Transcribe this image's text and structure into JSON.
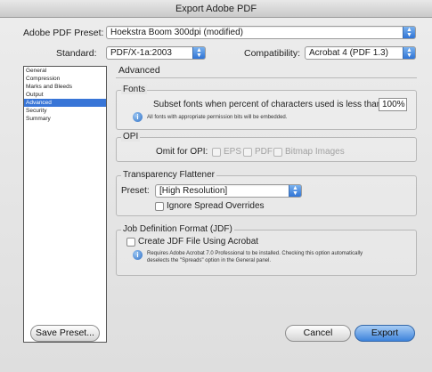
{
  "window": {
    "title": "Export Adobe PDF"
  },
  "preset": {
    "label": "Adobe PDF Preset:",
    "value": "Hoekstra Boom 300dpi (modified)"
  },
  "standard": {
    "label": "Standard:",
    "value": "PDF/X-1a:2003"
  },
  "compatibility": {
    "label": "Compatibility:",
    "value": "Acrobat 4 (PDF 1.3)"
  },
  "sidebar": {
    "items": [
      {
        "label": "General",
        "selected": false
      },
      {
        "label": "Compression",
        "selected": false
      },
      {
        "label": "Marks and Bleeds",
        "selected": false
      },
      {
        "label": "Output",
        "selected": false
      },
      {
        "label": "Advanced",
        "selected": true
      },
      {
        "label": "Security",
        "selected": false
      },
      {
        "label": "Summary",
        "selected": false
      }
    ]
  },
  "panel": {
    "title": "Advanced"
  },
  "fonts": {
    "title": "Fonts",
    "subset_label": "Subset fonts when percent of characters used is less than:",
    "subset_value": "100%",
    "note": "All fonts with appropriate permission bits will be embedded."
  },
  "opi": {
    "title": "OPI",
    "omit_label": "Omit for OPI:",
    "options": [
      {
        "label": "EPS"
      },
      {
        "label": "PDF"
      },
      {
        "label": "Bitmap Images"
      }
    ]
  },
  "transparency": {
    "title": "Transparency Flattener",
    "preset_label": "Preset:",
    "preset_value": "[High Resolution]",
    "ignore_label": "Ignore Spread Overrides"
  },
  "jdf": {
    "title": "Job Definition Format (JDF)",
    "create_label": "Create JDF File Using Acrobat",
    "note_line1": "Requires Adobe Acrobat 7.0 Professional to be installed. Checking this option automatically",
    "note_line2": "deselects the \"Spreads\" option in the General panel."
  },
  "buttons": {
    "save_preset": "Save Preset...",
    "cancel": "Cancel",
    "export": "Export"
  },
  "colors": {
    "accent": "#3875d7",
    "primary_button": "#3d83db"
  }
}
